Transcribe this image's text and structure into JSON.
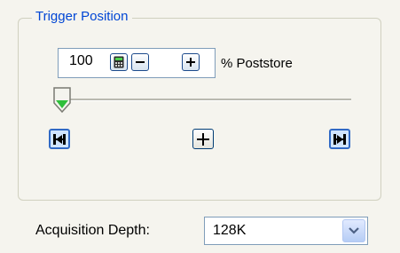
{
  "trigger_position": {
    "group_title": "Trigger Position",
    "value": "100",
    "unit_label": "% Poststore",
    "slider_position_percent": 0
  },
  "acquisition": {
    "label": "Acquisition Depth:",
    "selected_value": "128K"
  },
  "icons": {
    "calculator": "calculator-icon",
    "decrement": "minus-icon",
    "increment": "plus-icon",
    "goto_start": "skip-to-start-icon",
    "center": "center-crosshair-icon",
    "goto_end": "skip-to-end-icon",
    "dropdown": "chevron-down-icon"
  },
  "colors": {
    "group_title": "#0046d5",
    "nav_button_fill": "#cfe4ff",
    "accent": "#316ac5",
    "calculator_screen": "#1e7a1e"
  }
}
